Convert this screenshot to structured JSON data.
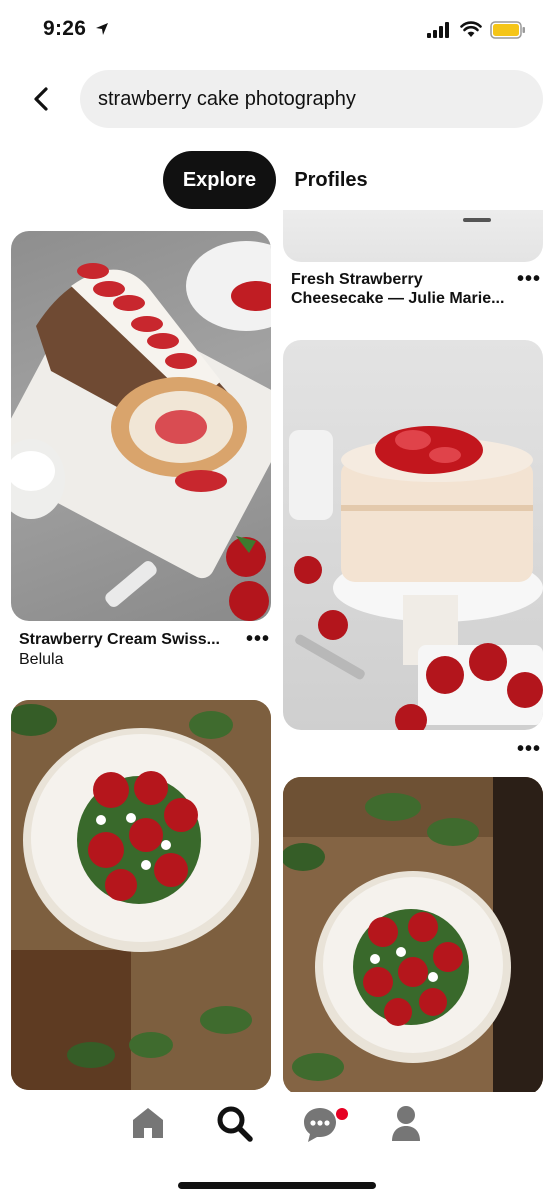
{
  "status_bar": {
    "time": "9:26"
  },
  "search": {
    "query": "strawberry cake photography"
  },
  "tabs": {
    "explore_label": "Explore",
    "profiles_label": "Profiles"
  },
  "pins": [
    {
      "title": "Fresh Strawberry",
      "title2": "Cheesecake — Julie Marie...",
      "more": "•••"
    },
    {
      "title": "Strawberry Cream Swiss...",
      "subtitle": "Belula",
      "more": "•••"
    },
    {
      "more": "•••"
    }
  ],
  "icons": {
    "back": "chevron-left-icon",
    "home": "home-icon",
    "search": "search-icon",
    "messages": "chat-icon",
    "profile": "profile-icon"
  },
  "colors": {
    "notification_dot": "#e60023",
    "battery": "#f5c518",
    "active_tab_bg": "#111111"
  }
}
